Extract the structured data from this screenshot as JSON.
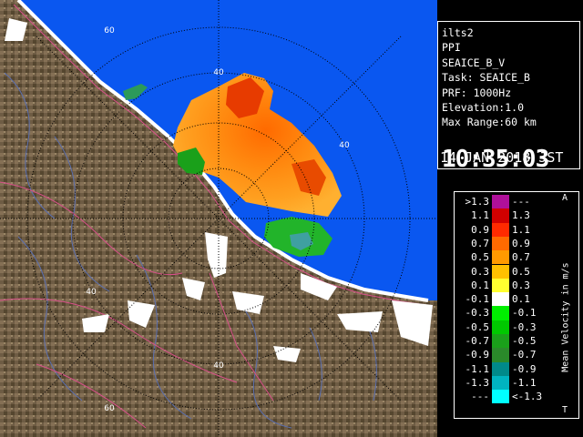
{
  "radar_view": {
    "range_labels": [
      "60",
      "40",
      "40",
      "40",
      "40",
      "60",
      "40"
    ],
    "colors": {
      "sea": "#0a57f0",
      "land": "#6b5a43",
      "coast": "#ffffff",
      "rings": "#000000",
      "roads": "#d8508a",
      "rivers": "#5a6fb0"
    }
  },
  "info_panel": {
    "station": "ilts2",
    "scan_type": "PPI",
    "product": "SEAICE_B_V",
    "task": "Task: SEAICE_B",
    "prf": "PRF: 1000Hz",
    "elevation": "Elevation:1.0",
    "max_range": "Max Range:60 km",
    "time": "10:35:03",
    "date": "14 JAN 2018 JST"
  },
  "legend": {
    "title": "Mean Velocity in m/s",
    "top_marker": "A",
    "bottom_marker": "T",
    "rows": [
      {
        "lo": ">1.3",
        "hi": "---",
        "color": "#b0109a"
      },
      {
        "lo": "1.1",
        "hi": "1.3",
        "color": "#d10000"
      },
      {
        "lo": "0.9",
        "hi": "1.1",
        "color": "#ff2a00"
      },
      {
        "lo": "0.7",
        "hi": "0.9",
        "color": "#ff6a00"
      },
      {
        "lo": "0.5",
        "hi": "0.7",
        "color": "#ff9a00"
      },
      {
        "lo": "0.3",
        "hi": "0.5",
        "color": "#ffc000"
      },
      {
        "lo": "0.1",
        "hi": "0.3",
        "color": "#ffff30"
      },
      {
        "lo": "-0.1",
        "hi": "0.1",
        "color": "#ffffff"
      },
      {
        "lo": "-0.3",
        "hi": "-0.1",
        "color": "#00ee00"
      },
      {
        "lo": "-0.5",
        "hi": "-0.3",
        "color": "#00c800"
      },
      {
        "lo": "-0.7",
        "hi": "-0.5",
        "color": "#1aa01a"
      },
      {
        "lo": "-0.9",
        "hi": "-0.7",
        "color": "#2a8a2a"
      },
      {
        "lo": "-1.1",
        "hi": "-0.9",
        "color": "#008a8a"
      },
      {
        "lo": "-1.3",
        "hi": "-1.1",
        "color": "#00b4c0"
      },
      {
        "lo": "---",
        "hi": "<-1.3",
        "color": "#00ffff"
      }
    ]
  }
}
